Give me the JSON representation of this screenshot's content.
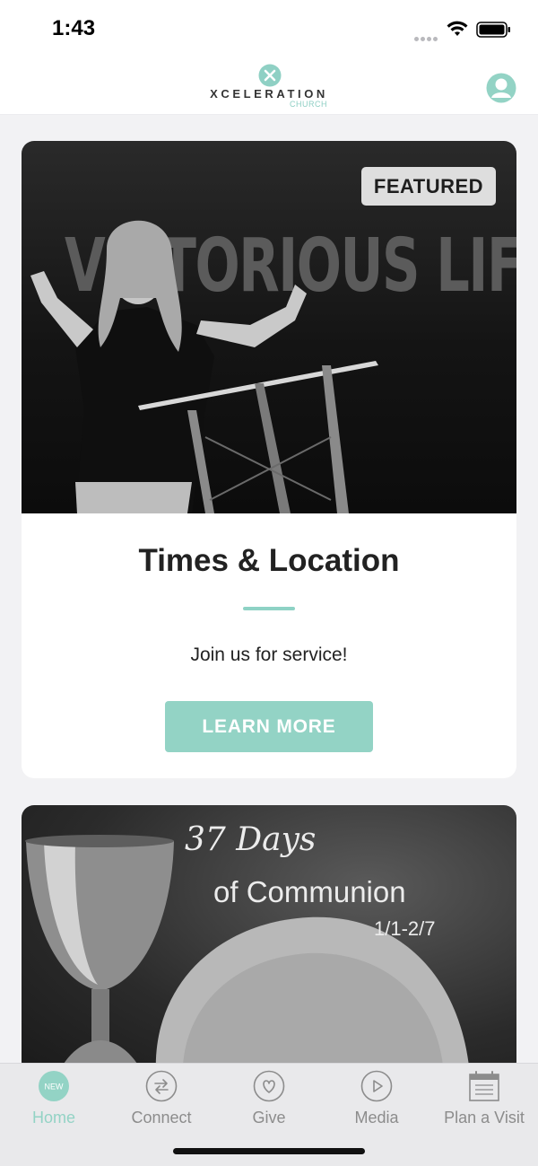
{
  "status_bar": {
    "time": "1:43"
  },
  "header": {
    "logo_name": "XCELERATION",
    "logo_sub": "CHURCH",
    "profile_icon": "profile-icon"
  },
  "featured_card": {
    "badge": "FEATURED",
    "image_text": "VICTORIOUS LIFE",
    "title": "Times & Location",
    "subtitle": "Join us for service!",
    "button_label": "LEARN MORE"
  },
  "promo_card": {
    "days_text": "37 Days",
    "title_text": "of Communion",
    "dates_text": "1/1-2/7"
  },
  "tab_bar": {
    "items": [
      {
        "label": "Home",
        "icon": "home-new-icon",
        "badge": "NEW",
        "active": true
      },
      {
        "label": "Connect",
        "icon": "connect-icon",
        "active": false
      },
      {
        "label": "Give",
        "icon": "heart-icon",
        "active": false
      },
      {
        "label": "Media",
        "icon": "play-icon",
        "active": false
      },
      {
        "label": "Plan a Visit",
        "icon": "calendar-icon",
        "active": false
      }
    ]
  },
  "colors": {
    "accent": "#93d3c5",
    "tab_inactive": "#8c8c8c",
    "badge_bg": "#dedede"
  }
}
